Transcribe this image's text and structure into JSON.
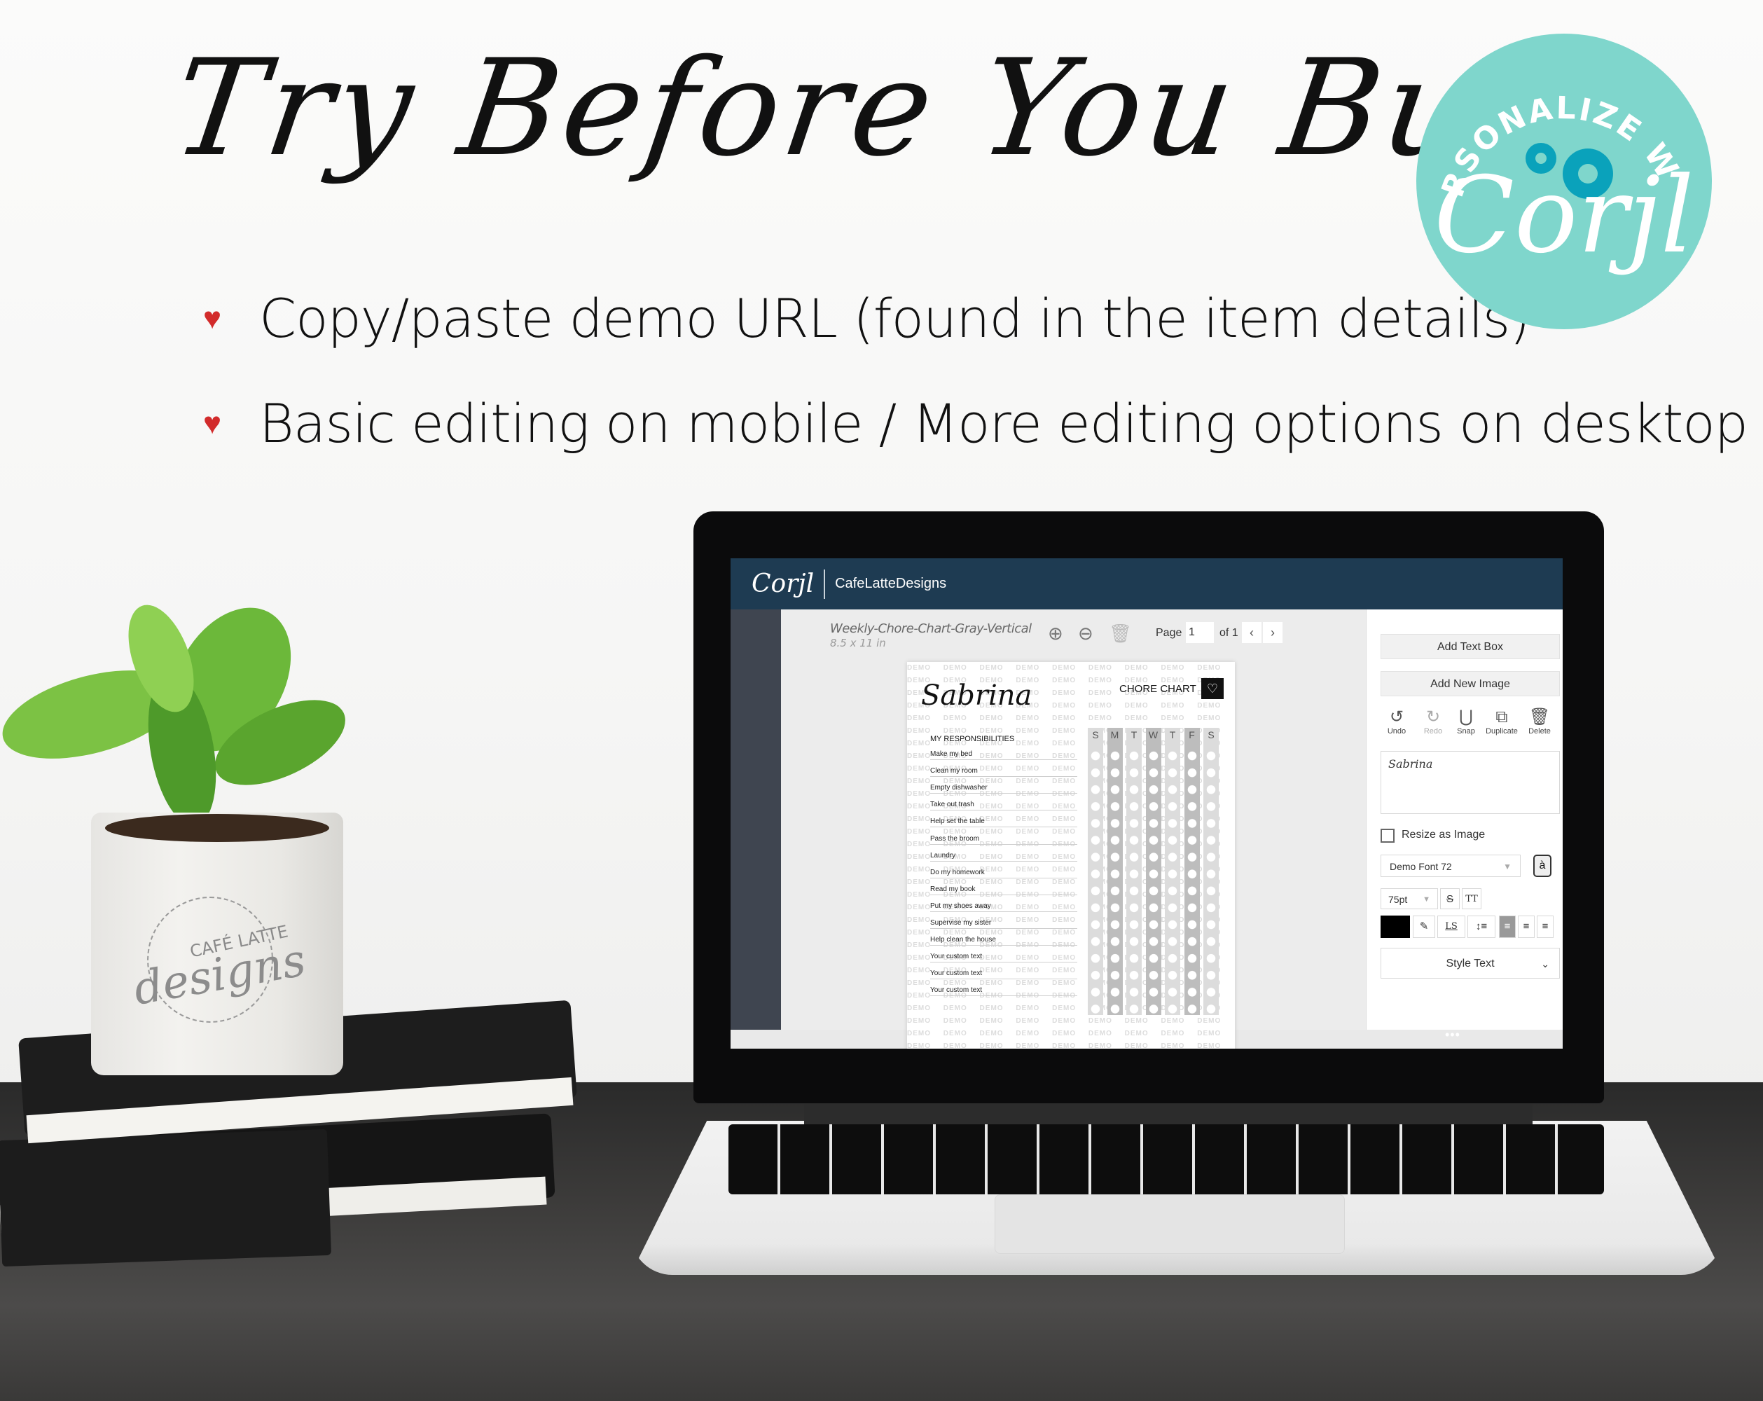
{
  "headline": "Try Before You Buy!",
  "bullets": [
    {
      "icon": "heart-icon",
      "text": "Copy/paste demo URL (found in the item details)"
    },
    {
      "icon": "heart-icon",
      "text": "Basic editing on mobile / More editing options on desktop"
    }
  ],
  "badge": {
    "arc_text": "PERSONALIZE WITH",
    "script": "Corjl",
    "icon": "gears-icon",
    "color": "#7fd6cc",
    "gear_color": "#0aa2bb"
  },
  "pot_logo": {
    "top": "CAFÉ LATTE",
    "script": "designs"
  },
  "app": {
    "logo": "Corjl",
    "shop": "CafeLatteDesigns",
    "doc_title": "Weekly-Chore-Chart-Gray-Vertical",
    "doc_size": "8.5 x 11 in",
    "page_label": "Page",
    "page_value": "1",
    "page_of": "of 1",
    "prev": "‹",
    "next": "›",
    "more": "•••",
    "colors": {
      "topbar": "#1e3b52",
      "rail": "#3f4550"
    }
  },
  "document": {
    "name": "Sabrina",
    "chart_title": "CHORE CHART",
    "heart": "♡",
    "resp_heading": "MY RESPONSIBILITIES",
    "chores": [
      "Make my bed",
      "Clean my room",
      "Empty dishwasher",
      "Take out trash",
      "Help set the table",
      "Pass the broom",
      "Laundry",
      "Do my homework",
      "Read my book",
      "Put my shoes away",
      "Supervise my sister",
      "Help clean the house",
      "Your custom text",
      "Your custom text",
      "Your custom text"
    ],
    "days": [
      "S",
      "M",
      "T",
      "W",
      "T",
      "F",
      "S"
    ],
    "watermark": "DEMO"
  },
  "panel": {
    "add_text_box": "Add Text Box",
    "add_new_image": "Add New Image",
    "actions": [
      {
        "icon": "↺",
        "label": "Undo"
      },
      {
        "icon": "↻",
        "label": "Redo"
      },
      {
        "icon": "⋃",
        "label": "Snap"
      },
      {
        "icon": "⧉",
        "label": "Duplicate"
      },
      {
        "icon": "🗑",
        "label": "Delete"
      }
    ],
    "text_value": "Sabrina",
    "resize_label": "Resize as Image",
    "font_value": "Demo Font 72",
    "glyph": "à",
    "size_value": "75pt",
    "strike": "S",
    "caps": "TT",
    "ls": "LS",
    "lh": "↕≡",
    "align_left": "≡",
    "align_center": "≡",
    "align_right": "≡",
    "eyedropper": "✎",
    "style_text": "Style Text",
    "chevron": "⌄",
    "color_value": "#000000"
  }
}
